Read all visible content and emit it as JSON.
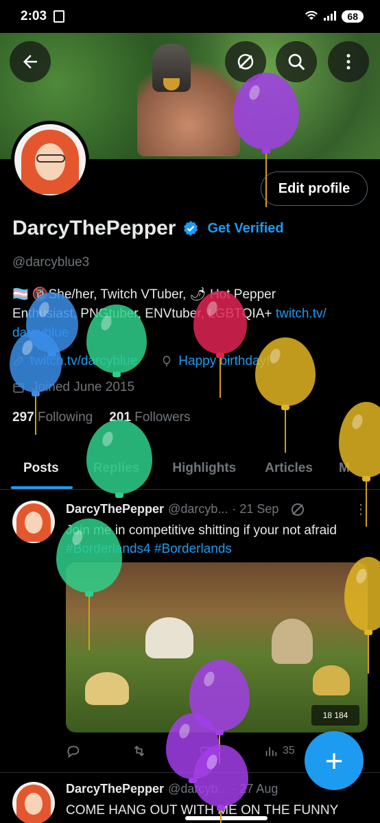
{
  "status_bar": {
    "time": "2:03",
    "battery": "68"
  },
  "profile": {
    "display_name": "DarcyThePepper",
    "get_verified": "Get Verified",
    "handle": "@darcyblue3",
    "edit_profile": "Edit profile",
    "bio_line1": "🏳️‍⚧️ 🔞She/her, Twitch VTuber, 🌶 Hot Pepper",
    "bio_line2_a": "Enthusiast, PNGtuber, ENVtuber, LGBTQIA+ ",
    "bio_link": "twitch.tv/",
    "bio_line3": "darcyblue",
    "website": "twitch.tv/darcyblue",
    "birthday": "Happy birthday!",
    "joined": "Joined June 2015",
    "following_count": "297",
    "following_label": "Following",
    "followers_count": "201",
    "followers_label": "Followers"
  },
  "tabs": [
    {
      "label": "Posts",
      "active": true
    },
    {
      "label": "Replies",
      "active": false
    },
    {
      "label": "Highlights",
      "active": false
    },
    {
      "label": "Articles",
      "active": false
    },
    {
      "label": "M",
      "active": false
    }
  ],
  "posts": [
    {
      "name": "DarcyThePepper",
      "handle": "@darcyb...",
      "date": "· 21 Sep",
      "text": "Join me in competitive  shitting if your not afraid ",
      "tag1": "#Borderlands4",
      "tag2": "#Borderlands",
      "views": "35",
      "hud": "18  184"
    },
    {
      "name": "DarcyThePepper",
      "handle": "@darcyb...",
      "date": "· 27 Aug",
      "text": "COME HANG OUT WITH ME ON THE FUNNY"
    }
  ],
  "icons": {
    "back": "back-arrow-icon",
    "grok": "grok-icon",
    "search": "search-icon",
    "more": "more-vertical-icon",
    "verified": "verified-badge-icon",
    "link": "link-icon",
    "balloon": "balloon-icon",
    "calendar": "calendar-icon",
    "reply": "reply-icon",
    "repost": "repost-icon",
    "like": "heart-icon",
    "views": "views-icon",
    "compose": "plus-icon"
  },
  "colors": {
    "accent": "#1d9bf0",
    "background": "#000000",
    "muted": "#71767b",
    "text": "#e7e9ea"
  }
}
